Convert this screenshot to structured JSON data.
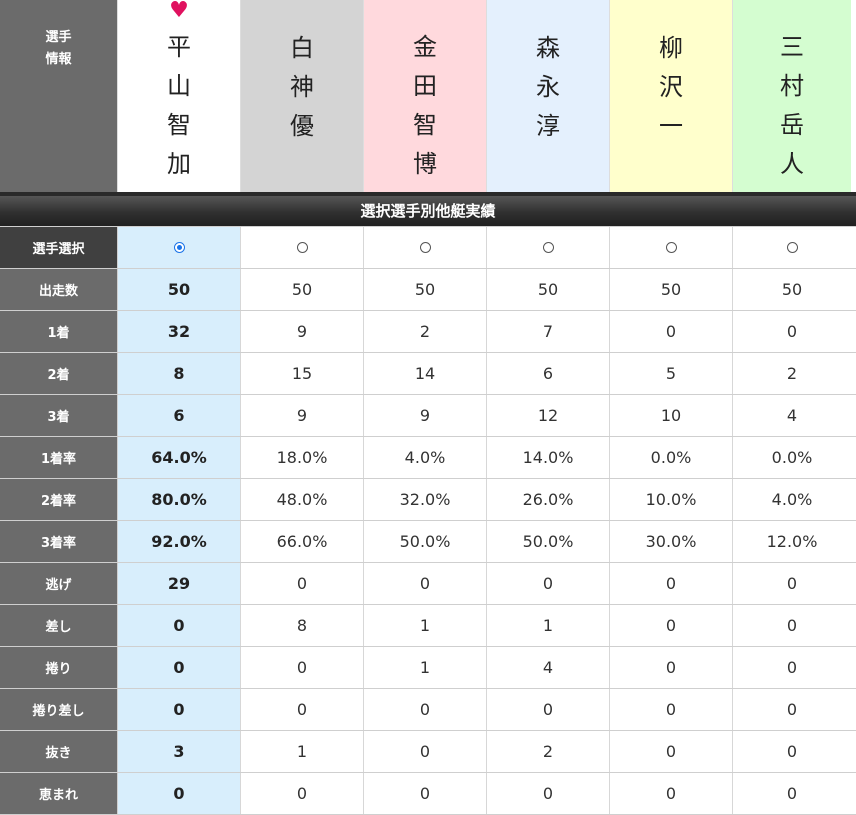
{
  "header": {
    "label_line1": "選手",
    "label_line2": "情報",
    "fav_icon": "♥"
  },
  "players": [
    {
      "name": "平山智加",
      "bg": "#ffffff",
      "favorite": true
    },
    {
      "name": "白神優",
      "bg": "#d4d4d4",
      "favorite": false
    },
    {
      "name": "金田智博",
      "bg": "#ffd9dd",
      "favorite": false
    },
    {
      "name": "森永淳",
      "bg": "#e4f0fd",
      "favorite": false
    },
    {
      "name": "柳沢一",
      "bg": "#ffffcc",
      "favorite": false
    },
    {
      "name": "三村岳人",
      "bg": "#d4fdd0",
      "favorite": false
    }
  ],
  "section_title": "選択選手別他艇実績",
  "selection_row_label": "選手選択",
  "selected_index": 0,
  "colors": {
    "selected_column": "#d8eefc",
    "label_bg": "#6b6b6b",
    "radio_on": "#1a73e8"
  },
  "stats": [
    {
      "label": "出走数",
      "values": [
        "50",
        "50",
        "50",
        "50",
        "50",
        "50"
      ]
    },
    {
      "label": "1着",
      "values": [
        "32",
        "9",
        "2",
        "7",
        "0",
        "0"
      ]
    },
    {
      "label": "2着",
      "values": [
        "8",
        "15",
        "14",
        "6",
        "5",
        "2"
      ]
    },
    {
      "label": "3着",
      "values": [
        "6",
        "9",
        "9",
        "12",
        "10",
        "4"
      ]
    },
    {
      "label": "1着率",
      "values": [
        "64.0%",
        "18.0%",
        "4.0%",
        "14.0%",
        "0.0%",
        "0.0%"
      ]
    },
    {
      "label": "2着率",
      "values": [
        "80.0%",
        "48.0%",
        "32.0%",
        "26.0%",
        "10.0%",
        "4.0%"
      ]
    },
    {
      "label": "3着率",
      "values": [
        "92.0%",
        "66.0%",
        "50.0%",
        "50.0%",
        "30.0%",
        "12.0%"
      ]
    },
    {
      "label": "逃げ",
      "values": [
        "29",
        "0",
        "0",
        "0",
        "0",
        "0"
      ]
    },
    {
      "label": "差し",
      "values": [
        "0",
        "8",
        "1",
        "1",
        "0",
        "0"
      ]
    },
    {
      "label": "捲り",
      "values": [
        "0",
        "0",
        "1",
        "4",
        "0",
        "0"
      ]
    },
    {
      "label": "捲り差し",
      "values": [
        "0",
        "0",
        "0",
        "0",
        "0",
        "0"
      ]
    },
    {
      "label": "抜き",
      "values": [
        "3",
        "1",
        "0",
        "2",
        "0",
        "0"
      ]
    },
    {
      "label": "恵まれ",
      "values": [
        "0",
        "0",
        "0",
        "0",
        "0",
        "0"
      ]
    }
  ]
}
